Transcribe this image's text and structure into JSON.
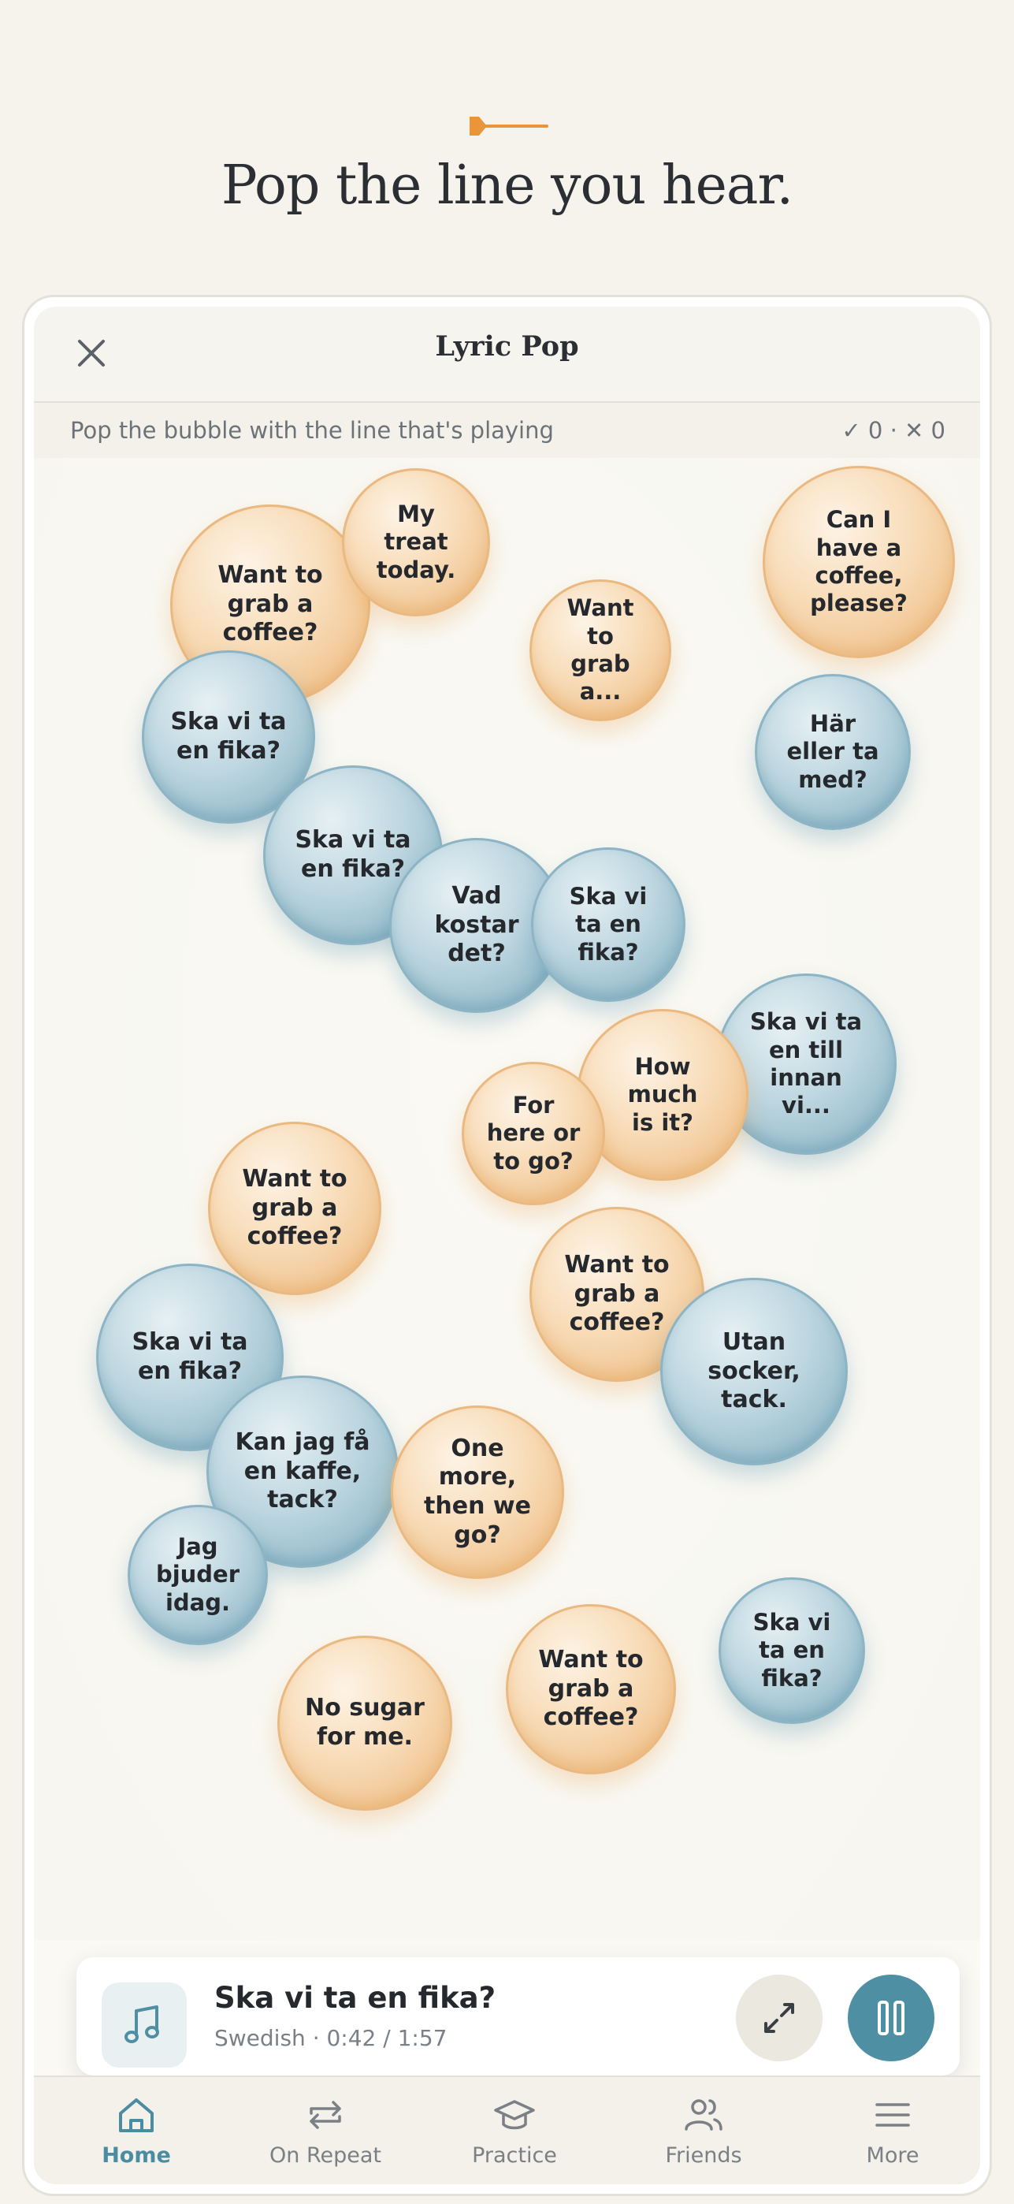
{
  "headline": "Pop the line you hear.",
  "game": {
    "title": "Lyric Pop",
    "instruction": "Pop the bubble with the line that's playing",
    "score": "✓ 0 · ✕ 0"
  },
  "bubbles": [
    {
      "text": "Want to grab a coffee?",
      "tone": "orange"
    },
    {
      "text": "My treat today.",
      "tone": "orange"
    },
    {
      "text": "Can I have a coffee, please?",
      "tone": "orange"
    },
    {
      "text": "Want to grab a...",
      "tone": "orange"
    },
    {
      "text": "Ska vi ta en fika?",
      "tone": "blue"
    },
    {
      "text": "Här eller ta med?",
      "tone": "blue"
    },
    {
      "text": "Ska vi ta en fika?",
      "tone": "blue"
    },
    {
      "text": "Vad kostar det?",
      "tone": "blue"
    },
    {
      "text": "Ska vi ta en fika?",
      "tone": "blue"
    },
    {
      "text": "Ska vi ta en till innan vi...",
      "tone": "blue"
    },
    {
      "text": "How much is it?",
      "tone": "orange"
    },
    {
      "text": "For here or to go?",
      "tone": "orange"
    },
    {
      "text": "Want to grab a coffee?",
      "tone": "orange"
    },
    {
      "text": "Want to grab a coffee?",
      "tone": "orange"
    },
    {
      "text": "Ska vi ta en fika?",
      "tone": "blue"
    },
    {
      "text": "Utan socker, tack.",
      "tone": "blue"
    },
    {
      "text": "Kan jag få en kaffe, tack?",
      "tone": "blue"
    },
    {
      "text": "One more, then we go?",
      "tone": "orange"
    },
    {
      "text": "Jag bjuder idag.",
      "tone": "blue"
    },
    {
      "text": "Ska vi ta en fika?",
      "tone": "blue"
    },
    {
      "text": "Want to grab a coffee?",
      "tone": "orange"
    },
    {
      "text": "No sugar for me.",
      "tone": "orange"
    }
  ],
  "player": {
    "title": "Ska vi ta en fika?",
    "meta": "Swedish · 0:42 / 1:57",
    "progress": 0.36
  },
  "tabs": [
    {
      "label": "Home",
      "icon": "home-icon",
      "active": true
    },
    {
      "label": "On Repeat",
      "icon": "repeat-icon",
      "active": false
    },
    {
      "label": "Practice",
      "icon": "graduation-cap-icon",
      "active": false
    },
    {
      "label": "Friends",
      "icon": "friends-icon",
      "active": false
    },
    {
      "label": "More",
      "icon": "menu-icon",
      "active": false
    }
  ],
  "colors": {
    "accent": "#4f8fa4",
    "brand_orange": "#e9963a",
    "bubble_orange": "#efc08a",
    "bubble_blue": "#8fb7c7"
  }
}
